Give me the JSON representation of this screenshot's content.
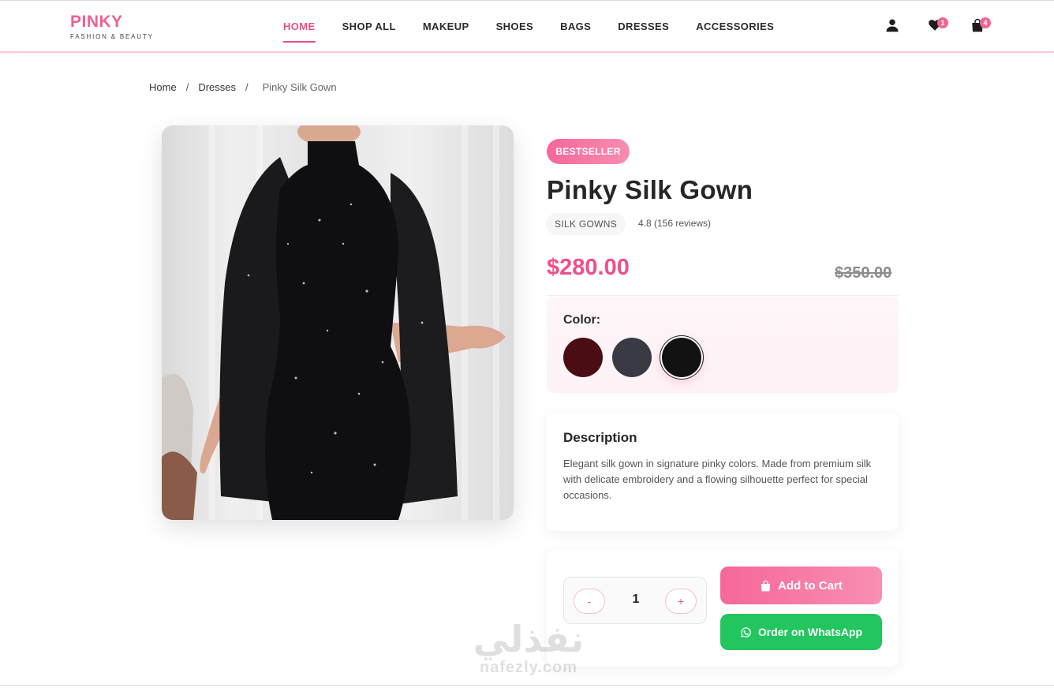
{
  "header": {
    "logo_title": "PINKY",
    "logo_subtitle": "FASHION & BEAUTY",
    "nav": [
      {
        "label": "HOME",
        "active": true
      },
      {
        "label": "SHOP ALL",
        "active": false
      },
      {
        "label": "MAKEUP",
        "active": false
      },
      {
        "label": "SHOES",
        "active": false
      },
      {
        "label": "BAGS",
        "active": false
      },
      {
        "label": "DRESSES",
        "active": false
      },
      {
        "label": "ACCESSORIES",
        "active": false
      }
    ],
    "icons": {
      "user": "user-icon",
      "wishlist": "heart-icon",
      "cart": "shopping-bag-icon"
    },
    "wishlist_count": "1",
    "cart_count": "4"
  },
  "breadcrumb": {
    "home": "Home",
    "category": "Dresses",
    "current": "Pinky Silk Gown",
    "separator": "/"
  },
  "product": {
    "badge": "BESTSELLER",
    "title": "Pinky Silk Gown",
    "category": "SILK GOWNS",
    "rating": "4.8 (156 reviews)",
    "price": "$280.00",
    "old_price": "$350.00",
    "color_label": "Color:",
    "colors": [
      {
        "name": "burgundy",
        "hex": "#4a0d14",
        "selected": false
      },
      {
        "name": "charcoal",
        "hex": "#393a44",
        "selected": false
      },
      {
        "name": "black",
        "hex": "#121212",
        "selected": true
      }
    ],
    "description_title": "Description",
    "description": "Elegant silk gown in signature pinky colors. Made from premium silk with delicate embroidery and a flowing silhouette perfect for special occasions.",
    "quantity": "1",
    "qty_minus": "-",
    "qty_plus": "+",
    "add_to_cart": "Add to Cart",
    "order_whatsapp": "Order on WhatsApp"
  },
  "watermark": {
    "arabic": "نفذلي",
    "latin": "nafezly.com"
  },
  "colors": {
    "accent": "#ef4f8c",
    "whatsapp": "#22c55e"
  }
}
